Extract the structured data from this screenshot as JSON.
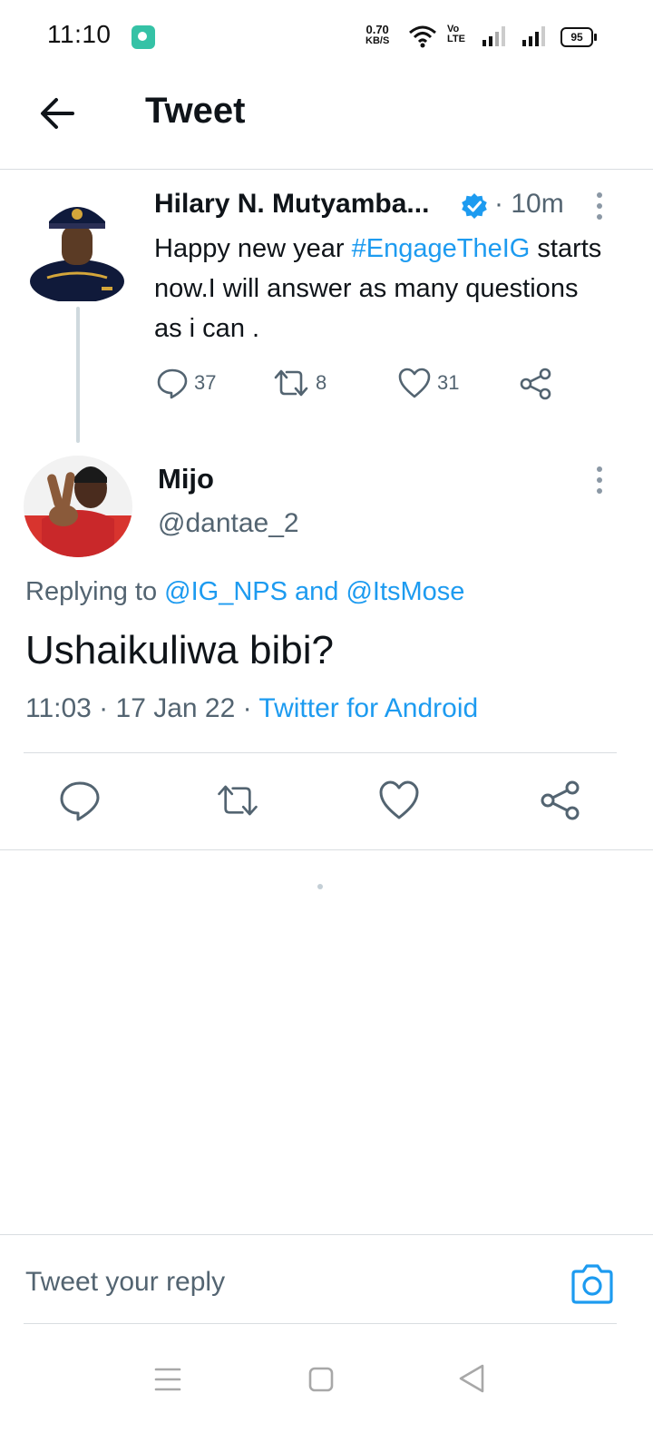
{
  "status_bar": {
    "time": "11:10",
    "net_speed_value": "0.70",
    "net_speed_unit": "KB/S",
    "volte_line1": "Vo",
    "volte_line2": "LTE",
    "battery": "95",
    "app_icon": "chat-app-icon",
    "app_icon_color": "#35c2a6"
  },
  "header": {
    "title": "Tweet",
    "back_icon": "arrow-left-icon"
  },
  "original_tweet": {
    "author": "Hilary N. Mutyamba...",
    "verified": true,
    "time": "· 10m",
    "text_before": "Happy new year ",
    "hashtag": "#EngageTheIG",
    "text_after": " starts now.I will answer as many questions as i can .",
    "replies": "37",
    "retweets": "8",
    "likes": "31"
  },
  "reply_tweet": {
    "name": "Mijo",
    "handle": "@dantae_2",
    "replying_label": "Replying to ",
    "replying_to": "@IG_NPS and @ItsMose",
    "text": "Ushaikuliwa bibi?",
    "time_date": "11:03 · 17 Jan 22 · ",
    "source": "Twitter for Android"
  },
  "composer": {
    "placeholder": "Tweet your reply",
    "camera_icon": "camera-icon"
  },
  "colors": {
    "accent": "#1d9bf0",
    "secondary_text": "#536471",
    "divider": "#d9dde1"
  }
}
